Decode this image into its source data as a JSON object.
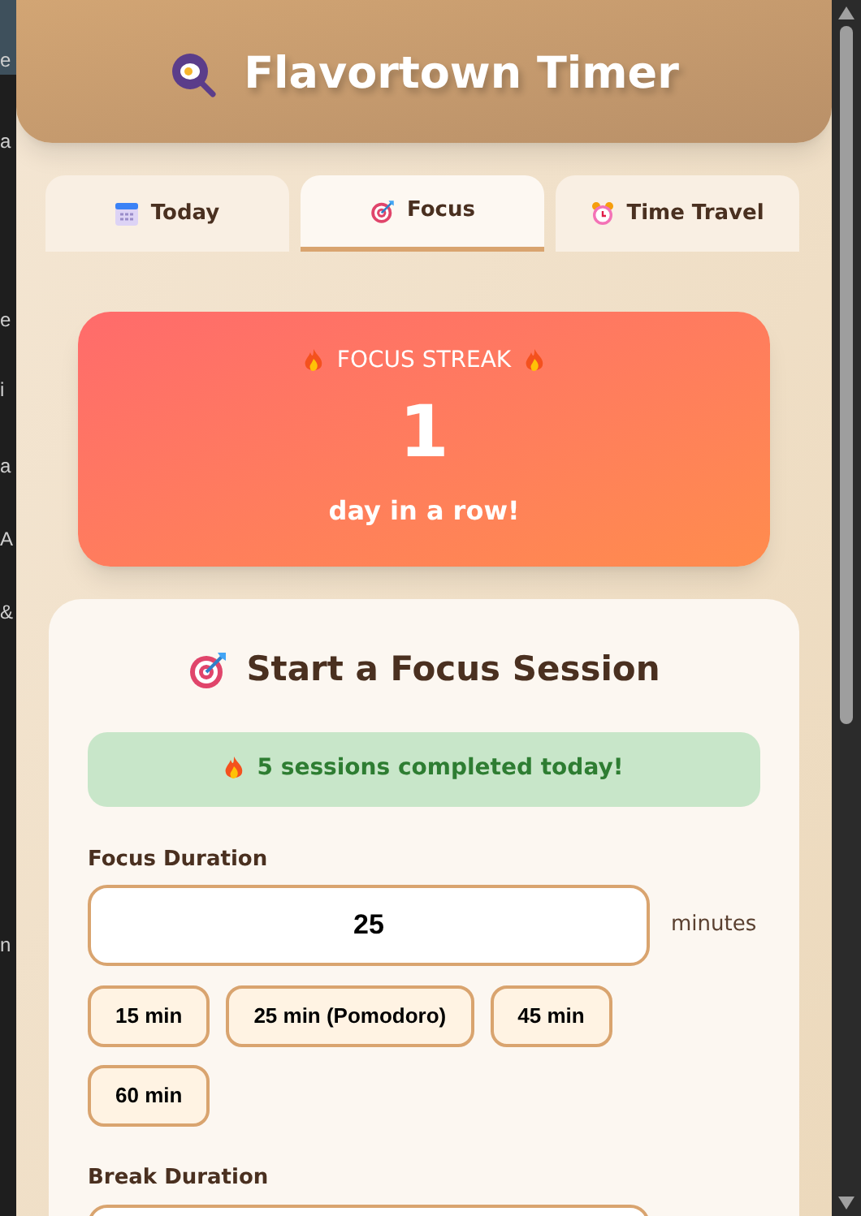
{
  "background_window": {
    "fragments": [
      "e",
      "a",
      "e",
      "i",
      "a",
      "A",
      "&",
      "n"
    ]
  },
  "header": {
    "title": "Flavortown Timer"
  },
  "tabs": [
    {
      "label": "Today",
      "selected": false
    },
    {
      "label": "Focus",
      "selected": true
    },
    {
      "label": "Time Travel",
      "selected": false
    }
  ],
  "streak": {
    "title": "FOCUS STREAK",
    "count": "1",
    "caption": "day in a row!"
  },
  "session": {
    "title": "Start a Focus Session",
    "banner": "5 sessions completed today!",
    "focus": {
      "label": "Focus Duration",
      "value": "25",
      "unit": "minutes",
      "presets": [
        "15 min",
        "25 min (Pomodoro)",
        "45 min",
        "60 min"
      ]
    },
    "break": {
      "label": "Break Duration"
    }
  }
}
